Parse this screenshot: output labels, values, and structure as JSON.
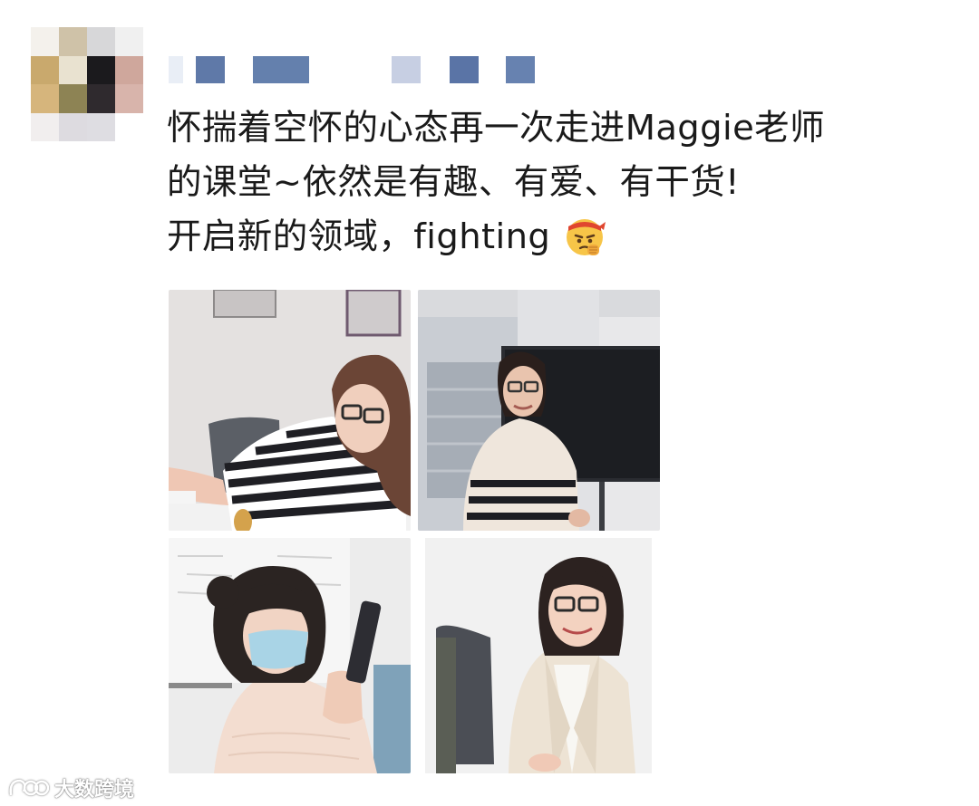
{
  "post": {
    "line1": "怀揣着空怀的心态再一次走进Maggie老师",
    "line2": "的课堂~依然是有趣、有爱、有干货!",
    "line3": "开启新的领域，fighting",
    "emoji": "fighting-face-emoji"
  },
  "author": {
    "avatar_icon": "pixelated-avatar",
    "name_icon": "pixelated-name"
  },
  "photos": [
    {
      "label": "student-in-striped-shirt"
    },
    {
      "label": "teacher-in-striped-sweater"
    },
    {
      "label": "student-with-mask-and-phone"
    },
    {
      "label": "student-in-beige-blazer"
    }
  ],
  "watermark": {
    "text": "大数跨境",
    "icon": "brand-logo-icon"
  },
  "colors": {
    "text": "#1a1a1a",
    "background": "#ffffff",
    "name_pixel": "#5a74a6"
  }
}
